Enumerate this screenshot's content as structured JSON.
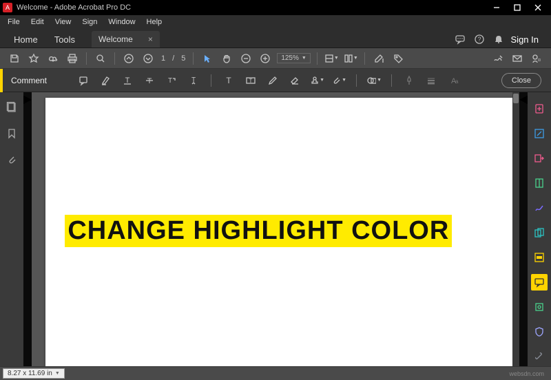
{
  "titlebar": {
    "title": "Welcome - Adobe Acrobat Pro DC"
  },
  "menubar": {
    "items": [
      "File",
      "Edit",
      "View",
      "Sign",
      "Window",
      "Help"
    ]
  },
  "tabbar": {
    "home": "Home",
    "tools": "Tools",
    "doc_tab": "Welcome",
    "signin": "Sign In"
  },
  "toolbar": {
    "page_current": "1",
    "page_sep": "/",
    "page_total": "5",
    "zoom": "125%"
  },
  "commentbar": {
    "label": "Comment",
    "close": "Close"
  },
  "document": {
    "highlight_text": "CHANGE HIGHLIGHT COLOR"
  },
  "statusbar": {
    "dimensions": "8.27 x 11.69 in",
    "watermark": "websdn.com"
  },
  "colors": {
    "rp": [
      "#ef5b8d",
      "#3d9de6",
      "#ef5b8d",
      "#4ad18c",
      "#6aa6ff",
      "#2bc4c4",
      "#ffd400",
      "#ffd400",
      "#4ad18c",
      "#9da6ff",
      "#8a8f99"
    ]
  }
}
